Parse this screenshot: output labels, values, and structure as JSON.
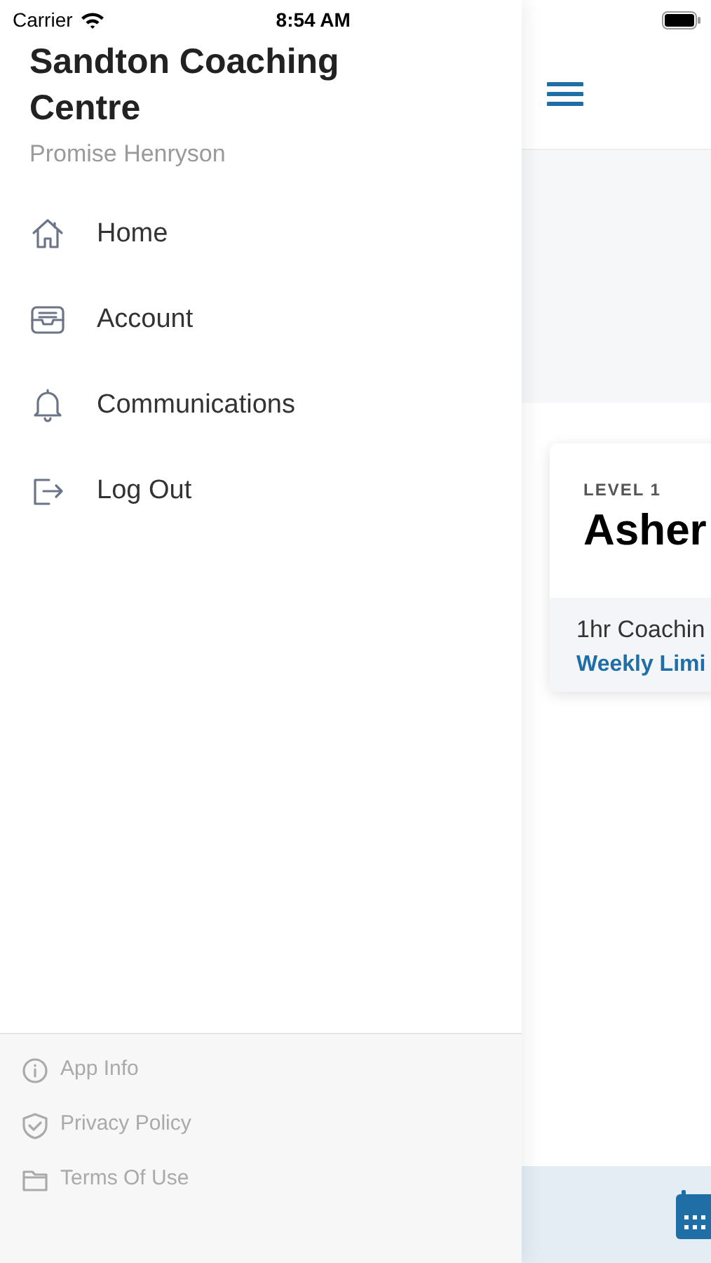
{
  "status_bar": {
    "carrier": "Carrier",
    "time": "8:54 AM"
  },
  "drawer": {
    "title": "Sandton Coaching Centre",
    "user": "Promise Henryson",
    "items": [
      {
        "kind": "home",
        "label": "Home"
      },
      {
        "kind": "account",
        "label": "Account"
      },
      {
        "kind": "bell",
        "label": "Communications"
      },
      {
        "kind": "logout",
        "label": "Log Out"
      }
    ],
    "footer_items": [
      {
        "kind": "info",
        "label": "App Info"
      },
      {
        "kind": "shield",
        "label": "Privacy Policy"
      },
      {
        "kind": "folder",
        "label": "Terms Of Use"
      }
    ]
  },
  "card": {
    "level": "LEVEL 1",
    "name": "Asher",
    "line_1": "1hr Coachin",
    "line_2": "Weekly Limi"
  }
}
